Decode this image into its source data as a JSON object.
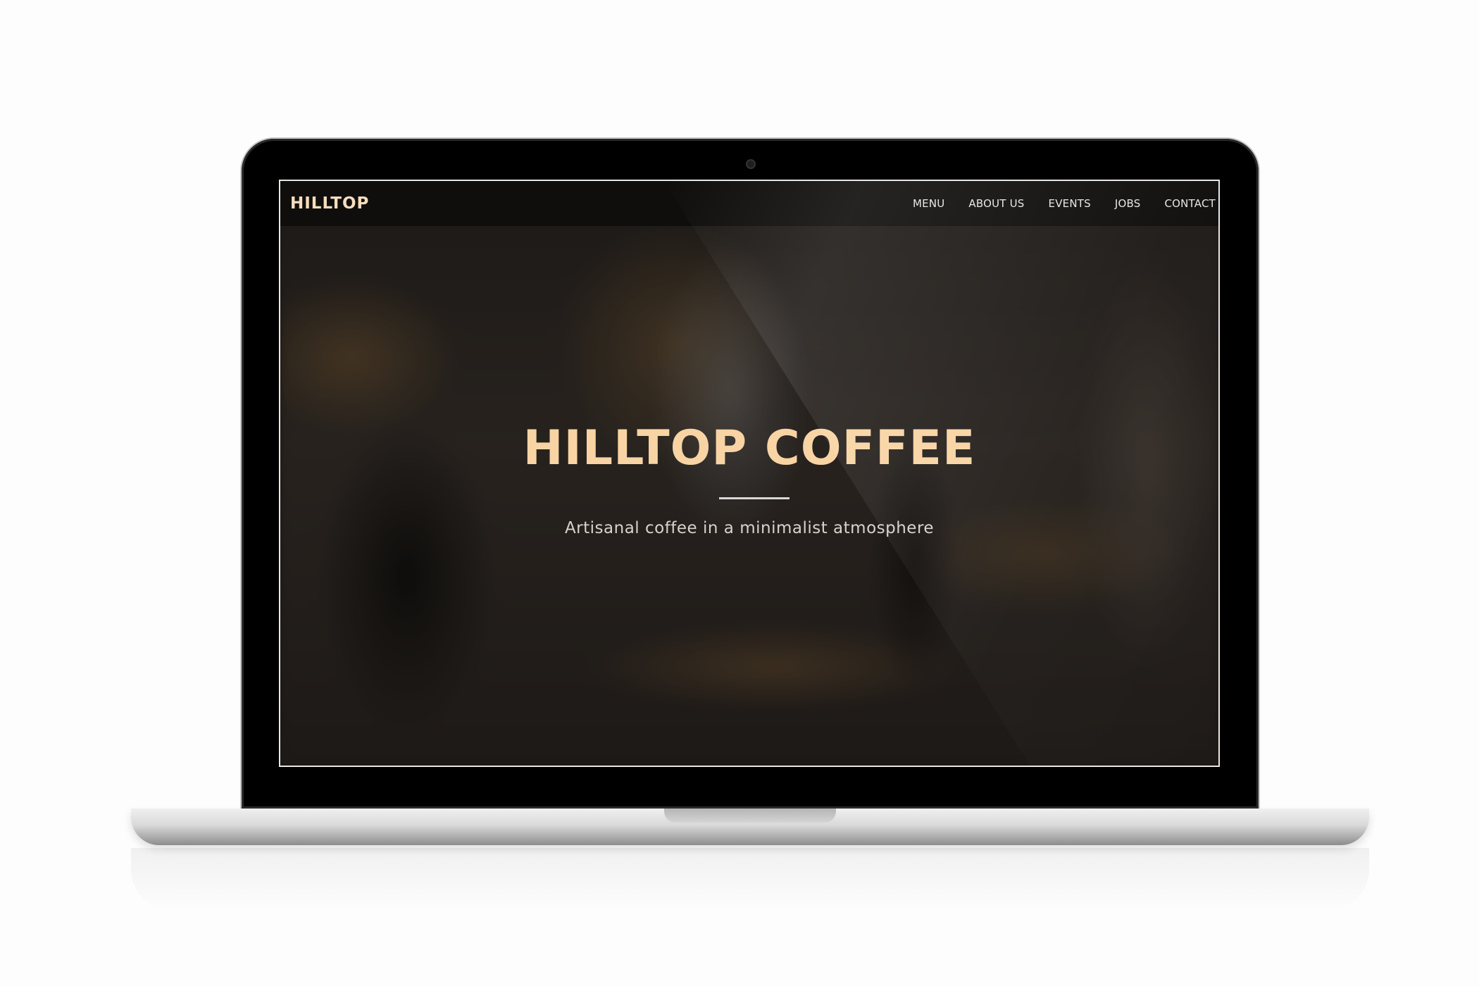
{
  "site": {
    "brand": "HILLTOP",
    "nav": {
      "items": [
        {
          "label": "MENU"
        },
        {
          "label": "ABOUT US"
        },
        {
          "label": "EVENTS"
        },
        {
          "label": "JOBS"
        },
        {
          "label": "CONTACT"
        }
      ]
    },
    "hero": {
      "title": "HILLTOP COFFEE",
      "subtitle": "Artisanal coffee in a minimalist atmosphere"
    }
  },
  "colors": {
    "accent": "#f8d4a4",
    "navbar_bg": "#0e0c0b",
    "nav_text": "#e6e6e6"
  }
}
